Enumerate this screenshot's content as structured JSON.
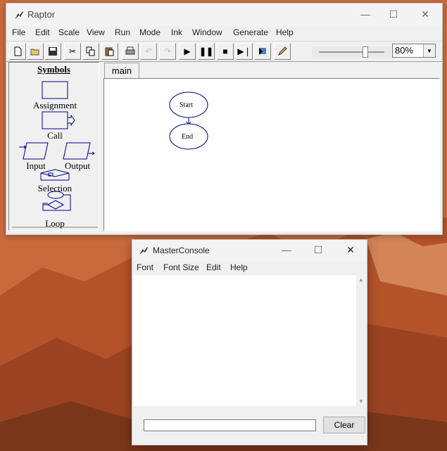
{
  "raptor": {
    "title": "Raptor",
    "menu": [
      "File",
      "Edit",
      "Scale",
      "View",
      "Run",
      "Mode",
      "Ink",
      "Window",
      "Generate",
      "Help"
    ],
    "toolbar": [
      "new-icon",
      "open-icon",
      "save-icon",
      "cut-icon",
      "copy-icon",
      "paste-icon",
      "print-icon",
      "undo-icon",
      "redo-icon",
      "run-icon",
      "pause-icon",
      "stop-icon",
      "step-icon",
      "test-icon",
      "pen-icon"
    ],
    "zoom": "80%",
    "slider_level_percent": 71,
    "symbols": {
      "title": "Symbols",
      "assignment": "Assignment",
      "call": "Call",
      "input": "Input",
      "output": "Output",
      "selection": "Selection",
      "loop": "Loop"
    },
    "tab": "main",
    "flow": {
      "start": "Start",
      "end": "End"
    }
  },
  "console": {
    "title": "MasterConsole",
    "menu": [
      "Font",
      "Font Size",
      "Edit",
      "Help"
    ],
    "clear_label": "Clear",
    "input_value": ""
  }
}
